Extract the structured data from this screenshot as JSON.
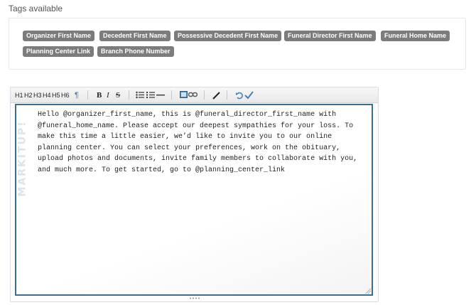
{
  "tags_section": {
    "title": "Tags available",
    "tags": [
      "Organizer First Name",
      "Decedent First Name",
      "Possessive Decedent First Name",
      "Funeral Director First Name",
      "Funeral Home Name",
      "Planning Center Link",
      "Branch Phone Number"
    ]
  },
  "editor": {
    "logo_text": "MARKITUP!",
    "toolbar": {
      "headings": [
        "H1",
        "H2",
        "H3",
        "H4",
        "H5",
        "H6"
      ],
      "paragraph_icon": "paragraph-icon",
      "bold": "B",
      "italic": "I",
      "strike": "S",
      "unordered_list_icon": "bulleted-list-icon",
      "ordered_list_icon": "numbered-list-icon",
      "horizontal_rule_icon": "horizontal-rule-icon",
      "image_icon": "image-icon",
      "link_icon": "link-icon",
      "clean_icon": "pen-clean-icon",
      "preview_icon": "undo-icon",
      "check_icon": "checkmark-icon"
    },
    "content": "Hello @organizer_first_name, this is @funeral_director_first_name with @funeral_home_name. Please accept our deepest sympathies for your loss. To make this time a little easier, we’d like to invite you to our online planning center. You can select your preferences, work on the obituary, upload photos and documents, invite family members to collaborate with you, and much more. To get started, go to @planning_center_link"
  },
  "colors": {
    "tag_bg": "#7c7c7c",
    "editor_border": "#3e6d92"
  }
}
